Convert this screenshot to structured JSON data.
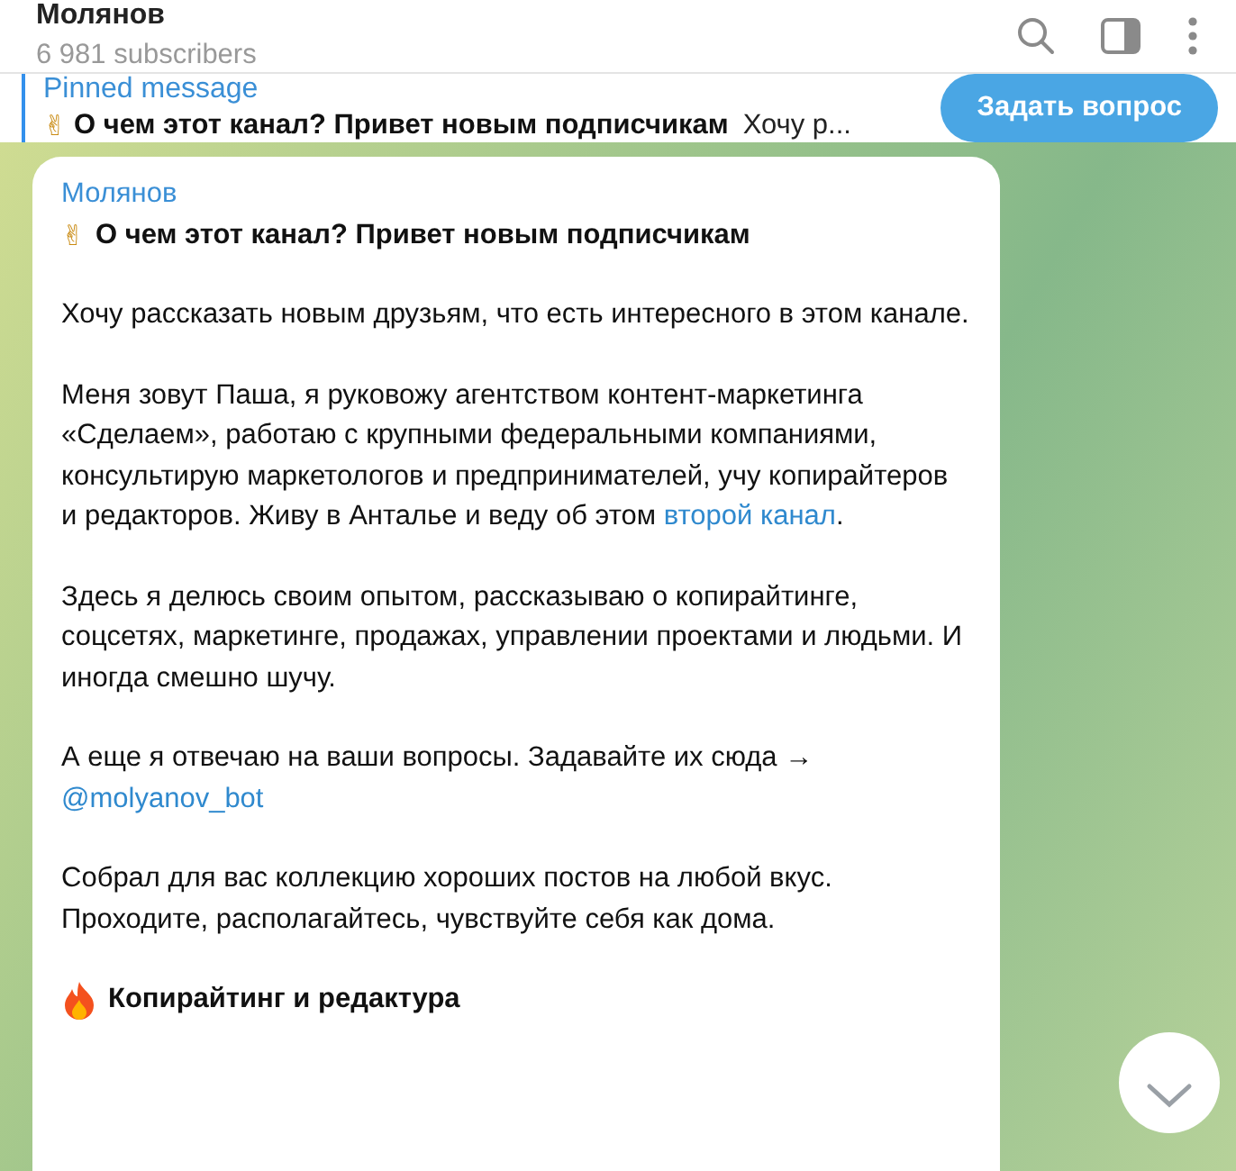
{
  "header": {
    "title": "Молянов",
    "subtitle": "6 981 subscribers"
  },
  "pinned": {
    "label": "Pinned message",
    "emoji": "✌",
    "title": "О чем этот канал? Привет новым подписчикам",
    "preview": "Хочу р...",
    "button": "Задать вопрос"
  },
  "post": {
    "author": "Молянов",
    "paragraphs": [
      {
        "kind": "heading",
        "emoji": "✌",
        "text": "О чем этот канал? Привет новым подписчикам"
      },
      {
        "kind": "text",
        "parts": [
          {
            "kind": "text",
            "text": "Хочу рассказать новым друзьям, что есть интересного в этом канале."
          }
        ]
      },
      {
        "kind": "text",
        "parts": [
          {
            "kind": "text",
            "text": "Меня зовут Паша, я руковожу агентством контент-маркетинга «Сделаем», работаю с крупными федеральными компаниями, консультирую маркетологов и предпринимателей, учу копирайтеров и редакторов. Живу в Анталье и веду об этом "
          },
          {
            "kind": "link",
            "text": "второй канал"
          },
          {
            "kind": "text",
            "text": "."
          }
        ]
      },
      {
        "kind": "text",
        "parts": [
          {
            "kind": "text",
            "text": "Здесь я делюсь своим опытом, рассказываю о копирайтинге, соцсетях, маркетинге, продажах, управлении проектами и людьми. И иногда смешно шучу."
          }
        ]
      },
      {
        "kind": "text",
        "parts": [
          {
            "kind": "text",
            "text": "А еще я отвечаю на ваши вопросы. Задавайте их сюда → "
          },
          {
            "kind": "link",
            "text": "@molyanov_bot"
          }
        ]
      },
      {
        "kind": "text",
        "parts": [
          {
            "kind": "text",
            "text": "Собрал для вас коллекцию хороших постов на любой вкус. Проходите, располагайтесь, чувствуйте себя как дома."
          }
        ]
      },
      {
        "kind": "fire_heading",
        "text": "Копирайтинг и редактура"
      }
    ]
  }
}
